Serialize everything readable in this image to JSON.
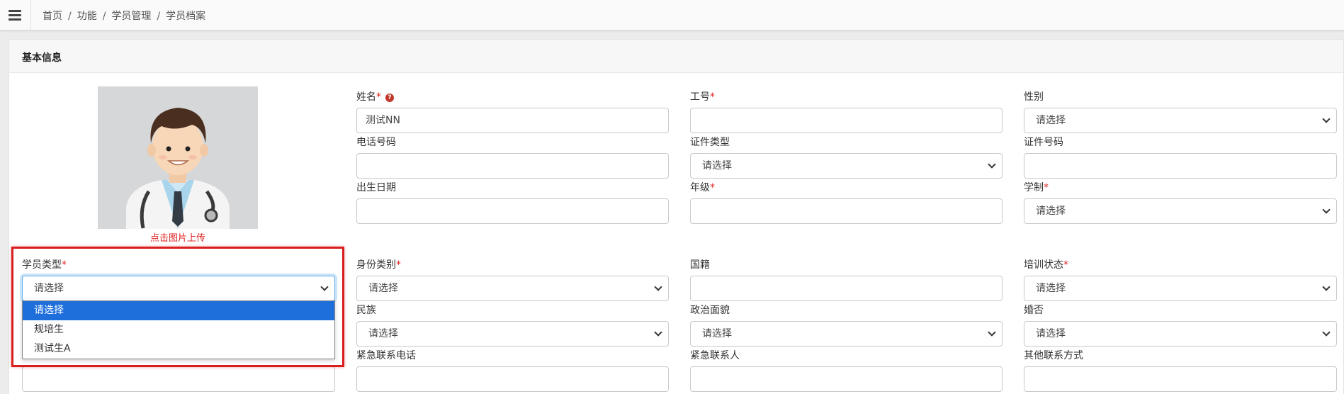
{
  "topbar": {
    "breadcrumb": [
      "首页",
      "功能",
      "学员管理",
      "学员档案"
    ]
  },
  "panel": {
    "title": "基本信息"
  },
  "avatar": {
    "upload_hint": "点击图片上传"
  },
  "form": {
    "name_label": "姓名",
    "name_value": "测试NN",
    "employee_no_label": "工号",
    "gender_label": "性别",
    "phone_label": "电话号码",
    "id_type_label": "证件类型",
    "id_no_label": "证件号码",
    "birth_label": "出生日期",
    "grade_label": "年级",
    "schooling_label": "学制",
    "student_type_label": "学员类型",
    "identity_label": "身份类别",
    "nationality_label": "国籍",
    "training_status_label": "培训状态",
    "ethnicity_label": "民族",
    "political_label": "政治面貌",
    "marital_label": "婚否",
    "emergency_phone_label": "紧急联系电话",
    "emergency_contact_label": "紧急联系人",
    "other_contact_label": "其他联系方式",
    "select_placeholder": "请选择",
    "required_mark": "*"
  },
  "student_type_dropdown": {
    "options": [
      "请选择",
      "规培生",
      "测试生A"
    ],
    "selected": "请选择"
  },
  "colors": {
    "required": "#e02020",
    "highlight_border": "#d81e1e",
    "dropdown_selected": "#1e6fdc"
  }
}
